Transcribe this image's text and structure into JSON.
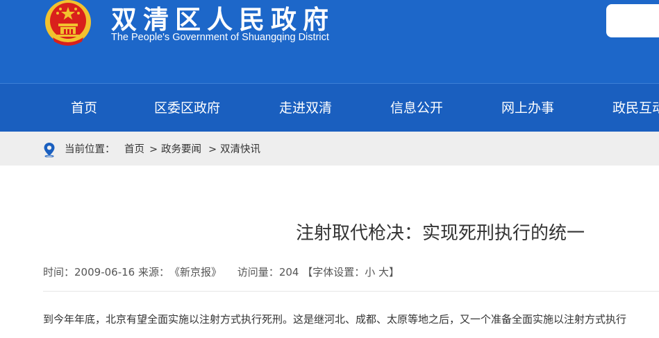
{
  "header": {
    "title": "双清区人民政府",
    "subtitle": "The People's Government of Shuangqing District",
    "emblem_icon": "national-emblem-icon",
    "colors": {
      "header_bg": "#1d67c9",
      "nav_bg": "#1a5fbf",
      "emblem_red": "#d9201c",
      "emblem_gold": "#f2c22e"
    }
  },
  "nav": {
    "items": [
      "首页",
      "区委区政府",
      "走进双清",
      "信息公开",
      "网上办事",
      "政民互动"
    ]
  },
  "breadcrumb": {
    "icon": "location-pin-icon",
    "label": "当前位置：",
    "items": [
      "首页",
      "政务要闻",
      "双清快讯"
    ],
    "separator": ">"
  },
  "article": {
    "title": "注射取代枪决：实现死刑执行的统一",
    "meta": {
      "time_label": "时间：",
      "time": "2009-06-16",
      "source_label": "来源：",
      "source": "《新京报》",
      "views_label": "访问量：",
      "views": "204",
      "font_label": "【字体设置：",
      "font_small": "小",
      "font_large": "大",
      "font_close": "】"
    },
    "first_line": "到今年年底，北京有望全面实施以注射方式执行死刑。这是继河北、成都、太原等地之后，又一个准备全面实施以注射方式执行"
  }
}
